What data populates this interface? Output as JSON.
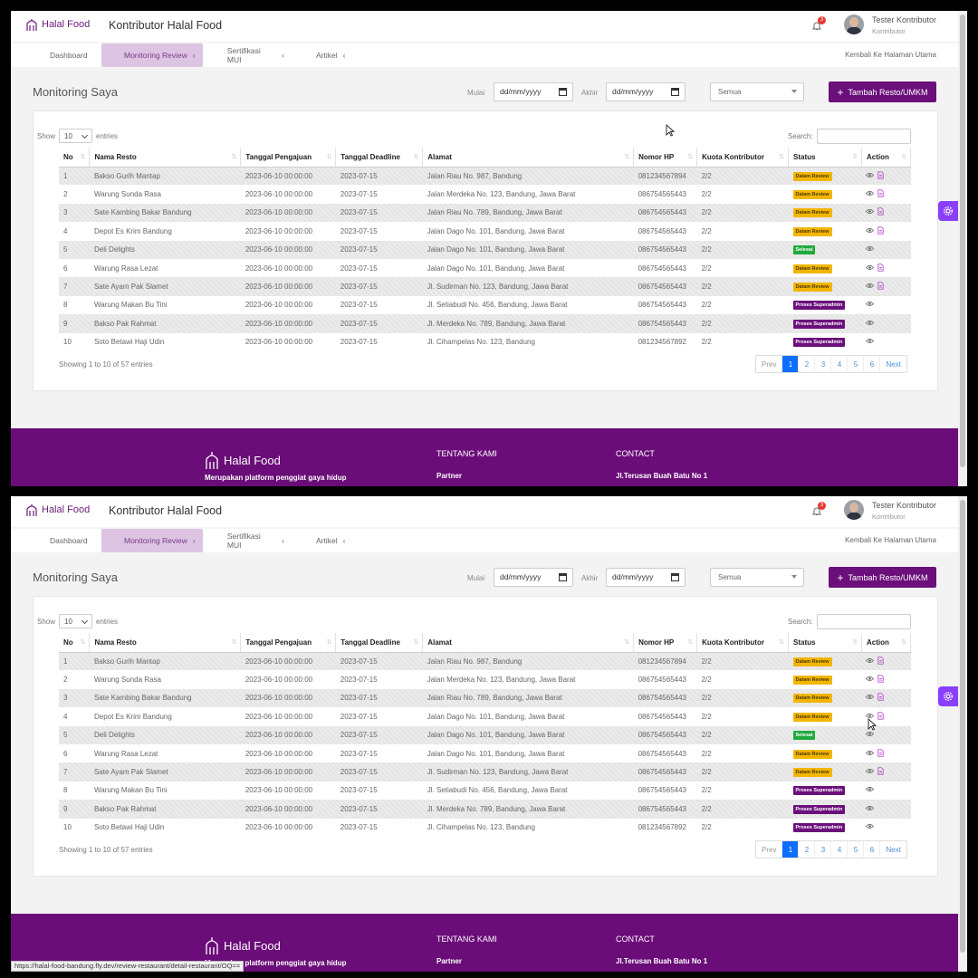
{
  "brand": "Halal Food",
  "app_title": "Kontributor Halal Food",
  "notifications": "3",
  "user": {
    "name": "Tester Kontributor",
    "role": "Kontributor"
  },
  "nav": [
    {
      "label": "Dashboard",
      "icon": "home-icon",
      "active": false,
      "chev": ""
    },
    {
      "label": "Monitoring Review",
      "icon": "document-icon",
      "active": true,
      "chev": "‹"
    },
    {
      "label": "Sertifikasi MUI",
      "icon": "list-icon",
      "active": false,
      "chev": "‹"
    },
    {
      "label": "Artikel",
      "icon": "article-icon",
      "active": false,
      "chev": "‹"
    }
  ],
  "nav_back": "Kembali Ke Halaman Utama",
  "page_title": "Monitoring Saya",
  "filters": {
    "start_label": "Mulai",
    "end_label": "Akhir",
    "date_placeholder": "dd/mm/yyyy",
    "status_value": "Semua"
  },
  "add_button": "Tambah Resto/UMKM",
  "table": {
    "show_label": "Show",
    "entries_value": "10",
    "entries_label": "entries",
    "search_label": "Search:",
    "headers": [
      "No",
      "Nama Resto",
      "Tanggal Pengajuan",
      "Tanggal Deadline",
      "Alamat",
      "Nomor HP",
      "Kuota Kontributor",
      "Status",
      "Action"
    ],
    "rows": [
      {
        "no": "1",
        "name": "Bakso Gurih Mantap",
        "submitted": "2023-06-10 00:00:00",
        "deadline": "2023-07-15",
        "address": "Jalan Riau No. 987, Bandung",
        "phone": "081234567894",
        "quota": "2/2",
        "status": "Dalam Review",
        "status_type": "review",
        "doc": true
      },
      {
        "no": "2",
        "name": "Warung Sunda Rasa",
        "submitted": "2023-06-10 00:00:00",
        "deadline": "2023-07-15",
        "address": "Jalan Merdeka No. 123, Bandung, Jawa Barat",
        "phone": "086754565443",
        "quota": "2/2",
        "status": "Dalam Review",
        "status_type": "review",
        "doc": true
      },
      {
        "no": "3",
        "name": "Sate Kambing Bakar Bandung",
        "submitted": "2023-06-10 00:00:00",
        "deadline": "2023-07-15",
        "address": "Jalan Riau No. 789, Bandung, Jawa Barat",
        "phone": "086754565443",
        "quota": "2/2",
        "status": "Dalam Review",
        "status_type": "review",
        "doc": true
      },
      {
        "no": "4",
        "name": "Depot Es Krim Bandung",
        "submitted": "2023-06-10 00:00:00",
        "deadline": "2023-07-15",
        "address": "Jalan Dago No. 101, Bandung, Jawa Barat",
        "phone": "086754565443",
        "quota": "2/2",
        "status": "Dalam Review",
        "status_type": "review",
        "doc": true
      },
      {
        "no": "5",
        "name": "Deli Delights",
        "submitted": "2023-06-10 00:00:00",
        "deadline": "2023-07-15",
        "address": "Jalan Dago No. 101, Bandung, Jawa Barat",
        "phone": "086754565443",
        "quota": "2/2",
        "status": "Selesai",
        "status_type": "done",
        "doc": false
      },
      {
        "no": "6",
        "name": "Warung Rasa Lezat",
        "submitted": "2023-06-10 00:00:00",
        "deadline": "2023-07-15",
        "address": "Jalan Dago No. 101, Bandung, Jawa Barat",
        "phone": "086754565443",
        "quota": "2/2",
        "status": "Dalam Review",
        "status_type": "review",
        "doc": true
      },
      {
        "no": "7",
        "name": "Sate Ayam Pak Slamet",
        "submitted": "2023-06-10 00:00:00",
        "deadline": "2023-07-15",
        "address": "Jl. Sudirman No. 123, Bandung, Jawa Barat",
        "phone": "086754565443",
        "quota": "2/2",
        "status": "Dalam Review",
        "status_type": "review",
        "doc": true
      },
      {
        "no": "8",
        "name": "Warung Makan Bu Tini",
        "submitted": "2023-06-10 00:00:00",
        "deadline": "2023-07-15",
        "address": "Jl. Setiabudi No. 456, Bandung, Jawa Barat",
        "phone": "086754565443",
        "quota": "2/2",
        "status": "Proses Superadmin",
        "status_type": "super",
        "doc": false
      },
      {
        "no": "9",
        "name": "Bakso Pak Rahmat",
        "submitted": "2023-06-10 00:00:00",
        "deadline": "2023-07-15",
        "address": "Jl. Merdeka No. 789, Bandung, Jawa Barat",
        "phone": "086754565443",
        "quota": "2/2",
        "status": "Proses Superadmin",
        "status_type": "super",
        "doc": false
      },
      {
        "no": "10",
        "name": "Soto Betawi Haji Udin",
        "submitted": "2023-06-10 00:00:00",
        "deadline": "2023-07-15",
        "address": "Jl. Cihampelas No. 123, Bandung",
        "phone": "081234567892",
        "quota": "2/2",
        "status": "Proses Superadmin",
        "status_type": "super",
        "doc": false
      }
    ],
    "info": "Showing 1 to 10 of 57 entries",
    "pagination": [
      "Prev",
      "1",
      "2",
      "3",
      "4",
      "5",
      "6",
      "Next"
    ],
    "active_page": "1"
  },
  "footer": {
    "brand": "Halal Food",
    "tagline": "Merupakan platform penggiat gaya hidup",
    "about_title": "TENTANG KAMI",
    "about_link": "Partner",
    "contact_title": "CONTACT",
    "contact_address": "Jl.Terusan Buah Batu No 1"
  },
  "status_url": "https://halal-food-bandung.fly.dev/review-restaurant/detail-restaurant/OQ==",
  "colors": {
    "brand": "#6a0d78",
    "review": "#f3b600",
    "done": "#1faa3c",
    "super": "#6b0f7b",
    "accent": "#8a3ffc",
    "page_active": "#0d6efd"
  }
}
